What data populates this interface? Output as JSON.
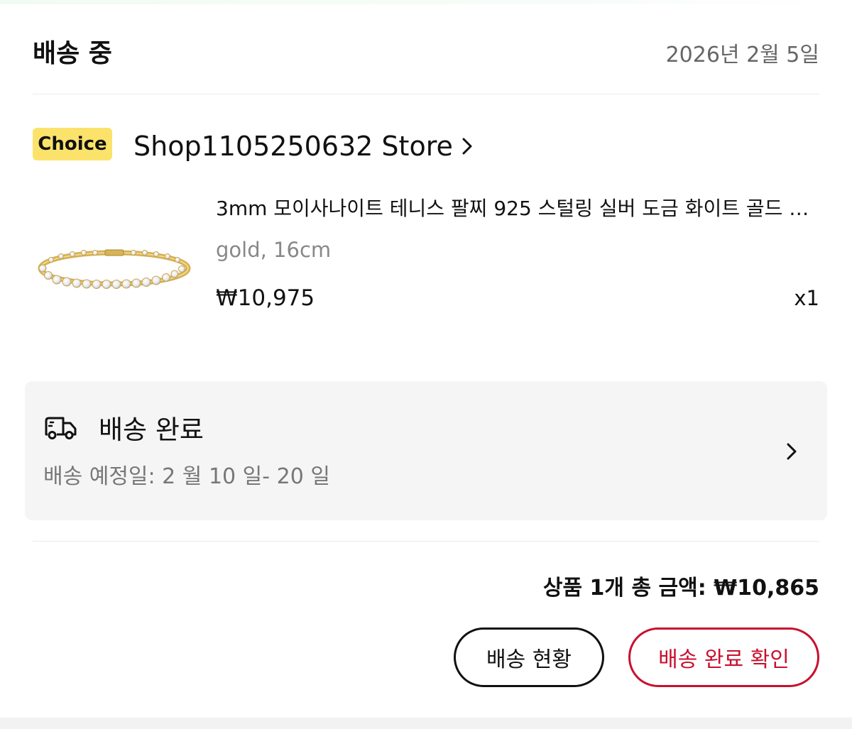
{
  "order": {
    "status": "배송 중",
    "date": "2026년 2월 5일"
  },
  "store": {
    "badge": "Choice",
    "name": "Shop1105250632 Store"
  },
  "product": {
    "title": "3mm 모이사나이트 테니스 팔찌 925 스털링 실버 도금 화이트 골드 팔찌 여성용 고급 주얼리 선물",
    "variant": "gold, 16cm",
    "price": "₩10,975",
    "quantity": "x1"
  },
  "shipping": {
    "status": "배송 완료",
    "eta": "배송 예정일: 2 월 10 일- 20 일"
  },
  "summary": {
    "total": "상품 1개 총 금액: ₩10,865"
  },
  "actions": {
    "track_label": "배송 현황",
    "confirm_label": "배송 완료 확인"
  },
  "colors": {
    "accent": "#c8102e",
    "badge": "#fbe36b"
  },
  "icons": {
    "store_arrow": "chevron-right-icon",
    "shipping": "truck-icon",
    "shipping_arrow": "chevron-right-icon",
    "product_image": "tennis-bracelet-image"
  }
}
